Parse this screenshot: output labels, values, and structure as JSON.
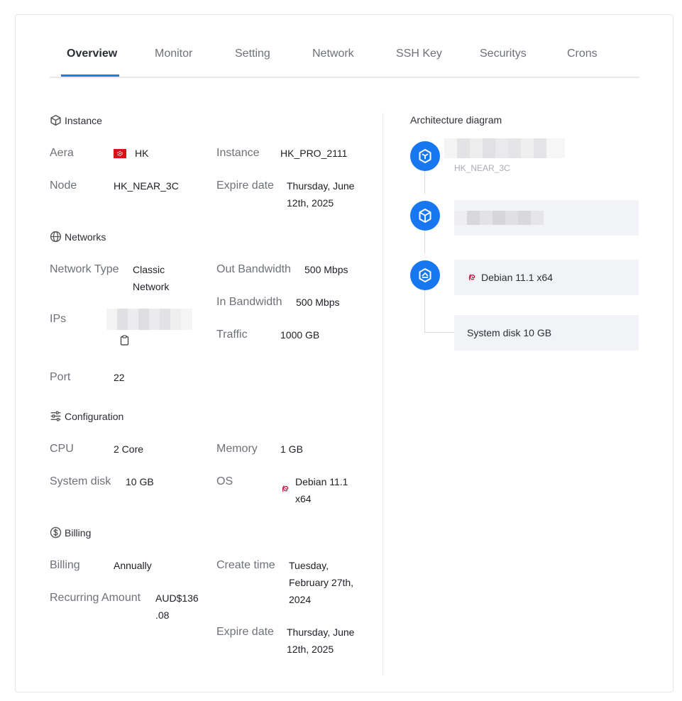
{
  "tabs": [
    {
      "label": "Overview",
      "active": true
    },
    {
      "label": "Monitor"
    },
    {
      "label": "Setting"
    },
    {
      "label": "Network"
    },
    {
      "label": "SSH Key"
    },
    {
      "label": "Securitys"
    },
    {
      "label": "Crons"
    }
  ],
  "instance": {
    "title": "Instance",
    "area_label": "Aera",
    "area_value": "HK",
    "instance_label": "Instance",
    "instance_value": "HK_PRO_2111",
    "node_label": "Node",
    "node_value": "HK_NEAR_3C",
    "expire_label": "Expire date",
    "expire_value_1": "Thursday, June",
    "expire_value_2": "12th, 2025"
  },
  "networks": {
    "title": "Networks",
    "type_label": "Network Type",
    "type_value_1": "Classic",
    "type_value_2": "Network",
    "out_bw_label": "Out Bandwidth",
    "out_bw_value": "500 Mbps",
    "in_bw_label": "In Bandwidth",
    "in_bw_value": "500 Mbps",
    "ips_label": "IPs",
    "traffic_label": "Traffic",
    "traffic_value": "1000 GB",
    "port_label": "Port",
    "port_value": "22"
  },
  "configuration": {
    "title": "Configuration",
    "cpu_label": "CPU",
    "cpu_value": "2 Core",
    "memory_label": "Memory",
    "memory_value": "1 GB",
    "disk_label": "System disk",
    "disk_value": "10 GB",
    "os_label": "OS",
    "os_value_1": "Debian 11.1",
    "os_value_2": "x64"
  },
  "billing": {
    "title": "Billing",
    "billing_label": "Billing",
    "billing_value": "Annually",
    "create_label": "Create time",
    "create_value_1": "Tuesday,",
    "create_value_2": "February 27th,",
    "create_value_3": "2024",
    "amount_label": "Recurring Amount",
    "amount_value_1": "AUD$136",
    "amount_value_2": ".08",
    "expire_label": "Expire date",
    "expire_value_1": "Thursday, June",
    "expire_value_2": "12th, 2025"
  },
  "architecture": {
    "title": "Architecture diagram",
    "node_sub": "HK_NEAR_3C",
    "os_box": "Debian 11.1 x64",
    "disk_box": "System disk 10 GB"
  },
  "colors": {
    "accent": "#1677f1",
    "tab_underline": "#1c7bf3",
    "debian": "#c70036"
  }
}
